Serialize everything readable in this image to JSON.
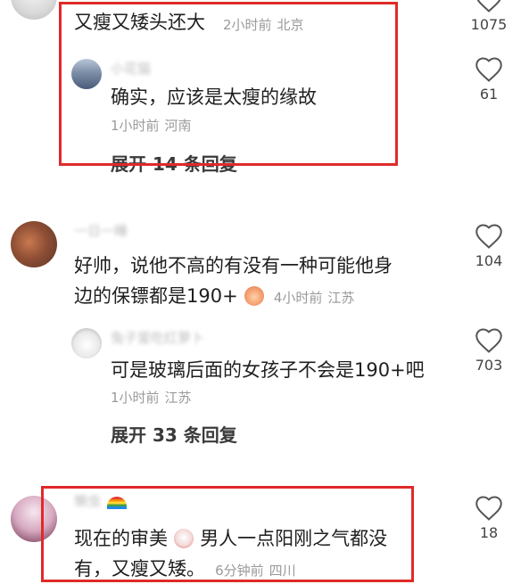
{
  "colors": {
    "highlight": "#e02a2a",
    "meta": "#9a9a9a",
    "text": "#1f1f1f"
  },
  "comments": [
    {
      "text": "又瘦又矮头还大",
      "time": "2小时前",
      "place": "北京",
      "likes": "1075",
      "reply": {
        "user": "小花猫",
        "text": "确实，应该是太瘦的缘故",
        "time": "1小时前",
        "place": "河南",
        "likes": "61"
      },
      "expand": "展开 14 条回复"
    },
    {
      "user": "一日一睡",
      "text_line1": "好帅，说他不高的有没有一种可能他身",
      "text_line2": "边的保镖都是190+",
      "emoji": "embarrassed-face-emoji",
      "time": "4小时前",
      "place": "江苏",
      "likes": "104",
      "reply": {
        "user": "兔子爱吃红萝卜",
        "text": "可是玻璃后面的女孩子不会是190+吧",
        "time": "1小时前",
        "place": "江苏",
        "likes": "703"
      },
      "expand": "展开 33 条回复"
    },
    {
      "user": "懒虫",
      "user_emoji": "rainbow-emoji",
      "text_part1": "现在的审美",
      "emoji": "crying-clown-emoji",
      "text_part2": "男人一点阳刚之气都没",
      "text_line2": "有，又瘦又矮。",
      "time": "6分钟前",
      "place": "四川",
      "likes": "18"
    }
  ]
}
